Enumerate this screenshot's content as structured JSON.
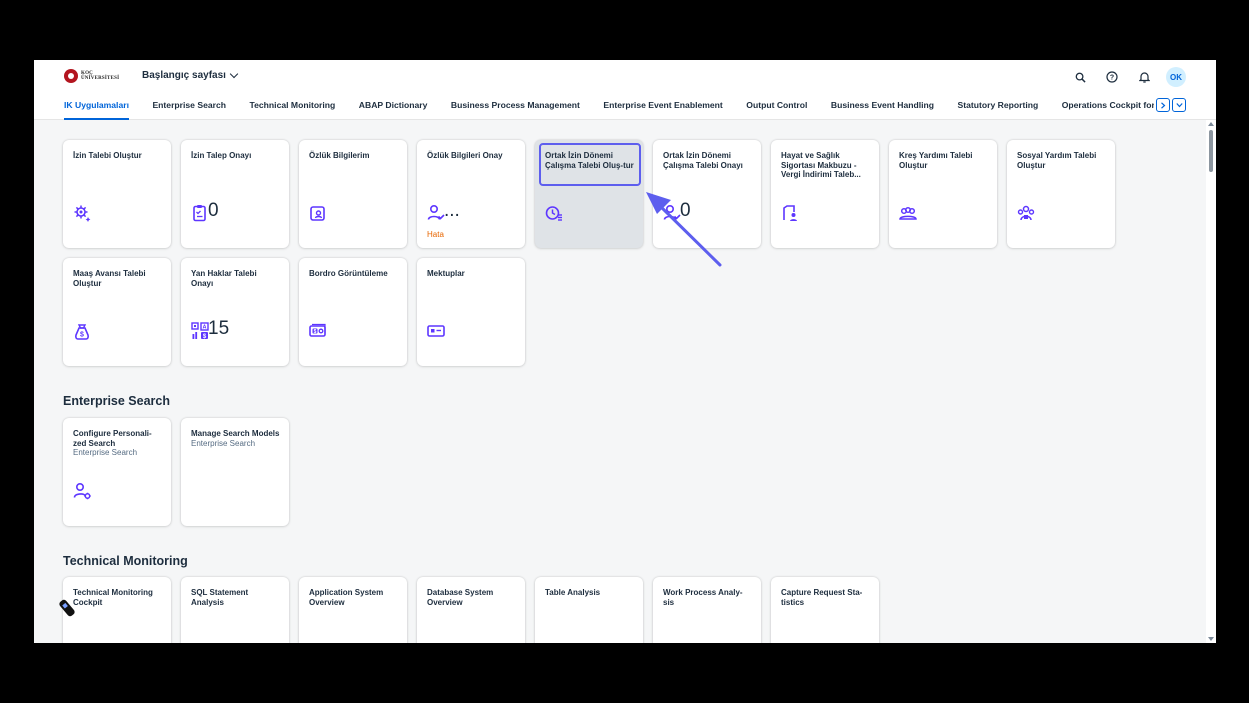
{
  "header": {
    "logo_line1": "KOÇ",
    "logo_line2": "ÜNİVERSİTESİ",
    "page_selector": "Başlangıç sayfası",
    "avatar_initials": "OK"
  },
  "tabs": [
    {
      "label": "IK Uygulamaları"
    },
    {
      "label": "Enterprise Search"
    },
    {
      "label": "Technical Monitoring"
    },
    {
      "label": "ABAP Dictionary"
    },
    {
      "label": "Business Process Management"
    },
    {
      "label": "Enterprise Event Enablement"
    },
    {
      "label": "Output Control"
    },
    {
      "label": "Business Event Handling"
    },
    {
      "label": "Statutory Reporting"
    },
    {
      "label": "Operations Cockpit for"
    }
  ],
  "ik": {
    "tiles": [
      {
        "title": "İzin Talebi Oluştur",
        "icon": "gear-sparkle-icon"
      },
      {
        "title": "İzin Talep Onayı",
        "icon": "clipboard-check-icon",
        "number": "0"
      },
      {
        "title": "Özlük Bilgilerim",
        "icon": "id-card-icon"
      },
      {
        "title": "Özlük Bilgileri Onay",
        "icon": "user-check-icon",
        "number": "...",
        "status": "Hata"
      },
      {
        "title": "Ortak İzin Dönemi Çalışma Talebi Oluş-tur",
        "icon": "clock-list-icon"
      },
      {
        "title": "Ortak İzin Dönemi Çalışma Talebi Onayı",
        "icon": "user-check-icon",
        "number": "0"
      },
      {
        "title": "Hayat ve Sağlık Sigortası Makbuzu - Vergi İndirimi Taleb...",
        "icon": "document-person-icon"
      },
      {
        "title": "Kreş Yardımı Talebi Oluştur",
        "icon": "group-icon"
      },
      {
        "title": "Sosyal Yardım Talebi Oluştur",
        "icon": "community-icon"
      },
      {
        "title": "Maaş Avansı Talebi Oluştur",
        "icon": "money-bag-icon"
      },
      {
        "title": "Yan Haklar Talebi Onayı",
        "icon": "qr-chart-icon",
        "number": "15"
      },
      {
        "title": "Bordro Görüntüleme",
        "icon": "payroll-icon"
      },
      {
        "title": "Mektuplar",
        "icon": "card-icon"
      }
    ]
  },
  "enterprise_search": {
    "title": "Enterprise Search",
    "tiles": [
      {
        "title": "Configure Personali-zed Search",
        "subtitle": "Enterprise Search",
        "icon": "user-settings-icon"
      },
      {
        "title": "Manage Search Models",
        "subtitle": "Enterprise Search"
      }
    ]
  },
  "technical_monitoring": {
    "title": "Technical Monitoring",
    "tiles": [
      {
        "title": "Technical Monitoring Cockpit"
      },
      {
        "title": "SQL Statement Analysis"
      },
      {
        "title": "Application System Overview"
      },
      {
        "title": "Database System Overview"
      },
      {
        "title": "Table Analysis"
      },
      {
        "title": "Work Process Analy-sis"
      },
      {
        "title": "Capture Request Sta-tistics"
      }
    ]
  },
  "colors": {
    "accent": "#0064d9",
    "icon": "#5d36ff",
    "annotation": "#5d5eee",
    "error": "#e76500"
  }
}
